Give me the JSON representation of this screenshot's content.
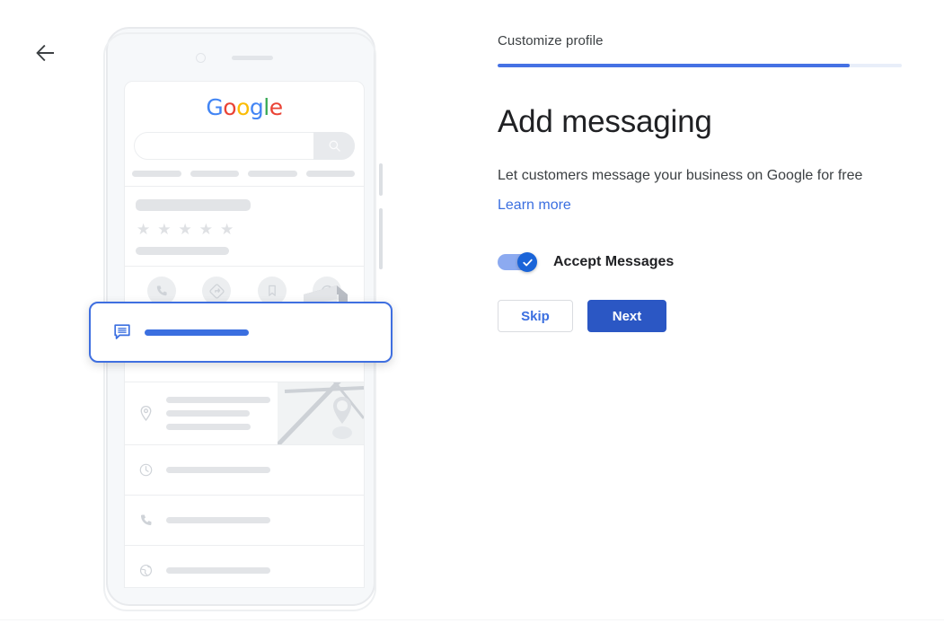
{
  "nav": {
    "back_icon": "arrow-left-icon"
  },
  "progress": {
    "step_label": "Customize profile",
    "percent": 87,
    "fill_color": "#4571e4",
    "track_color": "#e8eef9"
  },
  "main": {
    "title": "Add messaging",
    "subtitle": "Let customers message your business on Google for free",
    "learn_more": "Learn more",
    "learn_more_color": "#3b6fe0"
  },
  "toggle": {
    "label": "Accept Messages",
    "checked": true,
    "check_icon": "checkmark-icon",
    "knob_color": "#1a64d8",
    "track_color": "#8caaf0"
  },
  "buttons": {
    "skip": "Skip",
    "next": "Next",
    "next_bg": "#2b57c4"
  },
  "preview": {
    "logo": {
      "name": "google-logo",
      "letters": [
        {
          "char": "G",
          "color": "#4285F4"
        },
        {
          "char": "o",
          "color": "#EA4335"
        },
        {
          "char": "o",
          "color": "#FBBC05"
        },
        {
          "char": "g",
          "color": "#4285F4"
        },
        {
          "char": "l",
          "color": "#34A853"
        },
        {
          "char": "e",
          "color": "#EA4335"
        }
      ]
    },
    "search_icon": "search-icon",
    "rating_stars": 5,
    "star_glyph": "★",
    "action_icons": [
      "phone-icon",
      "directions-icon",
      "bookmark-icon",
      "globe-icon"
    ],
    "highlight_row": {
      "icon": "message-icon",
      "accent": "#3b6fe0"
    },
    "list_rows": [
      {
        "icon": "location-pin-icon",
        "has_map": true
      },
      {
        "icon": "clock-icon",
        "has_map": false
      },
      {
        "icon": "phone-icon",
        "has_map": false
      },
      {
        "icon": "globe-icon",
        "has_map": false
      }
    ],
    "storefront_icon": "storefront-icon"
  }
}
